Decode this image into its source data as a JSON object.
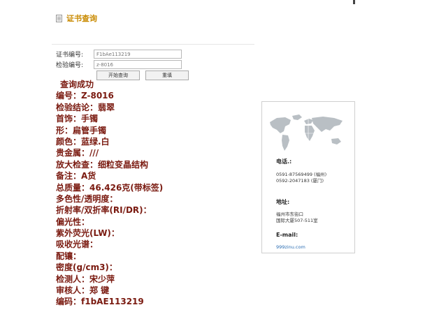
{
  "header": {
    "title": "证书查询"
  },
  "form": {
    "cert_label": "证书编号:",
    "cert_value": "F1bAe113219",
    "check_label": "检验编号:",
    "check_value": "z-8016",
    "search_button": "开始查询",
    "reset_button": "重填"
  },
  "result": {
    "lines": [
      "查询成功",
      "编号：Z-8016",
      "检验结论：翡翠",
      "首饰：手镯",
      "形：扁管手镯",
      "颜色：蓝绿.白",
      "贵金属：///",
      "放大检查：细粒变晶结构",
      "备注：A货",
      "总质量：46.426克(带标签)",
      "多色性/透明度：",
      "折射率/双折率(RI/DR)：",
      "偏光性：",
      "紫外荧光(LW)：",
      "吸收光谱：",
      "配镶：",
      "密度(g/cm3)：",
      "检测人：宋少萍",
      "审核人：郑 键",
      "编码：f1bAE113219"
    ]
  },
  "contact": {
    "phone_label": "电话.:",
    "phone1": "0591-87569499 (福州)",
    "phone2": "0592-2047183 (厦门)",
    "address_label": "地址:",
    "address1": "福州市东街口",
    "address2": "国际大厦507-511室",
    "email_label": "E-mail:",
    "website": "999zinu.com"
  }
}
